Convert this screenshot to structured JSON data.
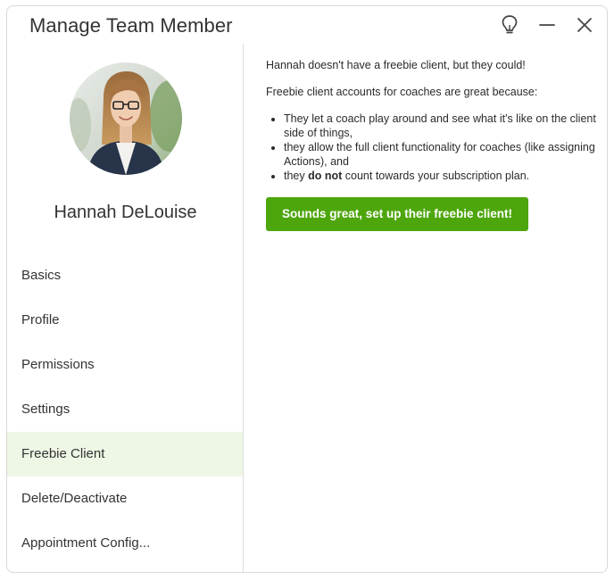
{
  "window": {
    "title": "Manage Team Member"
  },
  "title_actions": {
    "tips_icon": "lightbulb-icon",
    "minimize_icon": "minimize-icon",
    "close_icon": "close-icon"
  },
  "member": {
    "name": "Hannah DeLouise",
    "avatar_icon": "avatar-photo"
  },
  "sidebar": {
    "items": [
      {
        "label": "Basics",
        "active": false
      },
      {
        "label": "Profile",
        "active": false
      },
      {
        "label": "Permissions",
        "active": false
      },
      {
        "label": "Settings",
        "active": false
      },
      {
        "label": "Freebie Client",
        "active": true
      },
      {
        "label": "Delete/Deactivate",
        "active": false
      },
      {
        "label": "Appointment Config..."
      }
    ]
  },
  "content": {
    "intro": "Hannah doesn't have a freebie client, but they could!",
    "reasons_heading": "Freebie client accounts for coaches are great because:",
    "bullets": [
      "They let a coach play around and see what it's like on the client side of things,",
      "they allow the full client functionality for coaches (like assigning Actions), and"
    ],
    "bullet3_prefix": "they ",
    "bullet3_bold": "do not",
    "bullet3_suffix": " count towards your subscription plan.",
    "cta_label": "Sounds great, set up their freebie client!"
  },
  "colors": {
    "accent": "#4ea60d",
    "active_nav_bg": "#eef7e6",
    "border": "#d9d9d9"
  }
}
